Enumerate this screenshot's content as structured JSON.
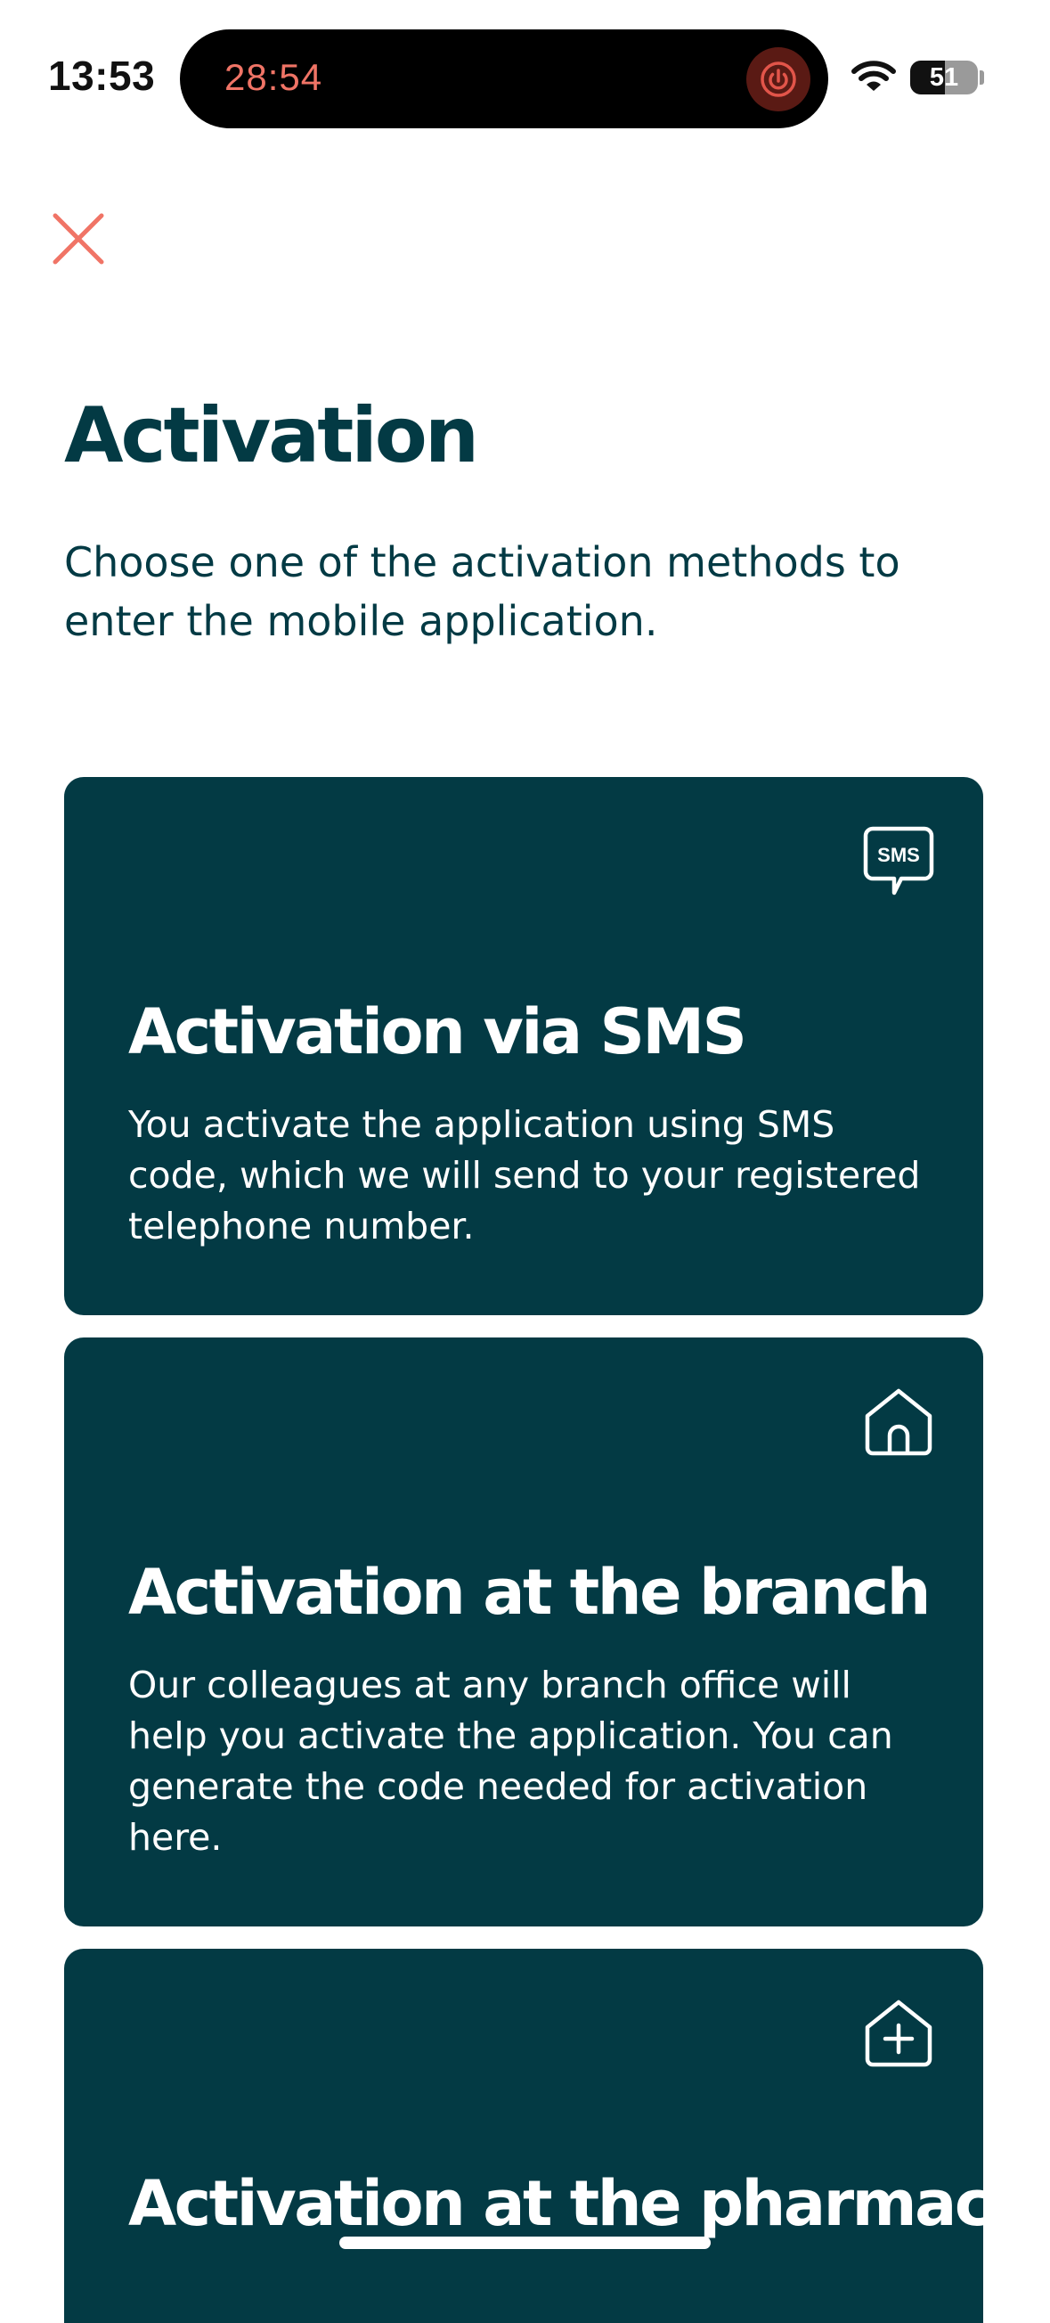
{
  "status_bar": {
    "time": "13:53",
    "timer": "28:54",
    "battery_level": "51",
    "battery_fraction": 0.51
  },
  "icons": {
    "close": "close-icon",
    "power": "power-icon",
    "wifi": "wifi-icon",
    "sms": "sms-bubble-icon",
    "branch": "house-icon",
    "pharmacy": "house-plus-icon"
  },
  "colors": {
    "primary": "#033a44",
    "accent": "#f07466",
    "background": "#ffffff"
  },
  "header": {
    "title": "Activation",
    "subtitle": "Choose one of the activation methods to enter the mobile application."
  },
  "methods": [
    {
      "title": "Activation via SMS",
      "description": "You activate the application using SMS code, which we will send to your registered telephone number.",
      "icon_text": "SMS"
    },
    {
      "title": "Activation at the branch",
      "description": "Our colleagues at any branch office will help you activate the application. You can generate the code needed for activation here."
    },
    {
      "title": "Activation at the pharmacy"
    }
  ]
}
